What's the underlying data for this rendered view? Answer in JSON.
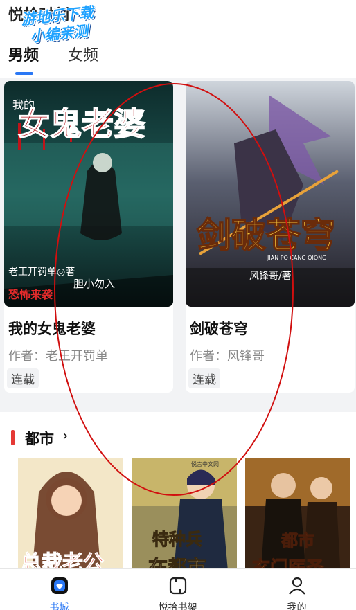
{
  "header": {
    "app_title": "悦拾时刻",
    "watermark_line1": "游地乐下载",
    "watermark_line2": "小编亲测",
    "tabs": [
      {
        "label": "男频",
        "active": true
      },
      {
        "label": "女频",
        "active": false
      }
    ]
  },
  "featured": [
    {
      "title": "我的女鬼老婆",
      "author": "作者：老王开罚单",
      "status": "连载",
      "cover_text_main": "女鬼老婆",
      "cover_text_top": "我的",
      "cover_text_author": "老王开罚单◎著",
      "cover_text_tag1": "恐怖来袭",
      "cover_text_tag2": "胆小勿入"
    },
    {
      "title": "剑破苍穹",
      "author": "作者：风锋哥",
      "status": "连载",
      "cover_text_main": "剑破苍穹",
      "cover_text_pinyin": "JIAN PO CANG QIONG",
      "cover_text_author": "风锋哥/著"
    }
  ],
  "section": {
    "title": "都市",
    "chevron": "›",
    "thumbs": [
      {
        "cover_text": "总裁老公"
      },
      {
        "cover_text": "特种兵",
        "cover_text2": "在都市",
        "publisher": "悦言中文网"
      },
      {
        "cover_text": "都市",
        "cover_text2": "玄门医圣"
      }
    ]
  },
  "nav": {
    "items": [
      {
        "label": "书城",
        "icon": "bookstore-icon",
        "active": true
      },
      {
        "label": "悦拾书架",
        "icon": "bookshelf-icon",
        "active": false
      },
      {
        "label": "我的",
        "icon": "profile-icon",
        "active": false
      }
    ]
  },
  "colors": {
    "accent": "#2a78f5",
    "section_bar": "#e53935",
    "annotation": "#d10f0f"
  }
}
